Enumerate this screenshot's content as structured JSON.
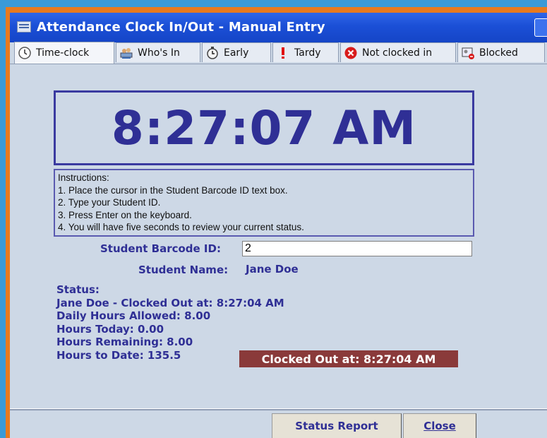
{
  "window": {
    "title": "Attendance Clock In/Out - Manual Entry"
  },
  "tabs": [
    {
      "label": "Time-clock",
      "icon": "clock-icon",
      "active": true
    },
    {
      "label": "Who's In",
      "icon": "people-icon"
    },
    {
      "label": "Early",
      "icon": "stopwatch-icon"
    },
    {
      "label": "Tardy",
      "icon": "exclamation-icon"
    },
    {
      "label": "Not clocked in",
      "icon": "red-x-icon"
    },
    {
      "label": "Blocked",
      "icon": "blocked-icon"
    }
  ],
  "clock": {
    "time": "8:27:07 AM"
  },
  "instructions": {
    "heading": "Instructions:",
    "steps": [
      "1. Place the cursor in the Student Barcode ID text box.",
      "2. Type your Student ID.",
      "3. Press Enter on the keyboard.",
      "4. You will have five seconds to review your current status."
    ]
  },
  "form": {
    "barcode_label": "Student Barcode ID:",
    "barcode_value": "2",
    "name_label": "Student Name:",
    "name_value": "Jane Doe"
  },
  "status": {
    "heading": "Status:",
    "lines": [
      "Jane Doe - Clocked Out at: 8:27:04 AM",
      "Daily Hours Allowed: 8.00",
      "Hours Today: 0.00",
      "Hours Remaining: 8.00",
      "Hours to Date: 135.5"
    ],
    "badge": "Clocked Out at: 8:27:04 AM",
    "badge_color": "#8a3a3a"
  },
  "buttons": {
    "status_report": "Status Report",
    "close": "Close"
  },
  "colors": {
    "accent_text": "#2f2f95",
    "titlebar": "#1b4fd6",
    "outer_frame": "#e87a1e"
  }
}
